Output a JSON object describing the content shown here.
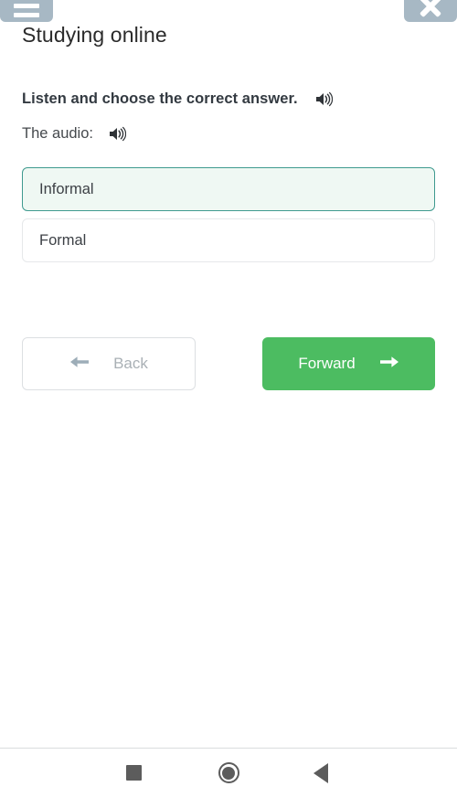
{
  "window": {
    "menu_button_icon": "hamburger-icon",
    "close_button_icon": "close-icon",
    "title": "Studying online"
  },
  "exercise": {
    "instruction": "Listen and choose the correct answer.",
    "instruction_audio_icon": "speaker-icon",
    "audio_label": "The audio:",
    "audio_icon": "speaker-icon",
    "options": [
      {
        "label": "Informal",
        "selected": true
      },
      {
        "label": "Formal",
        "selected": false
      }
    ]
  },
  "navigation": {
    "back_label": "Back",
    "back_icon": "arrow-left-icon",
    "forward_label": "Forward",
    "forward_icon": "arrow-right-icon"
  },
  "system_nav": {
    "recents_icon": "square-recents-icon",
    "home_icon": "circle-home-icon",
    "back_icon": "triangle-back-icon"
  },
  "colors": {
    "accent_green": "#4cbc61",
    "selected_border": "#3f9a8f",
    "selected_fill": "#eff8f3",
    "chrome_button": "#a7b8c4",
    "muted_text": "#a9b0b5"
  }
}
